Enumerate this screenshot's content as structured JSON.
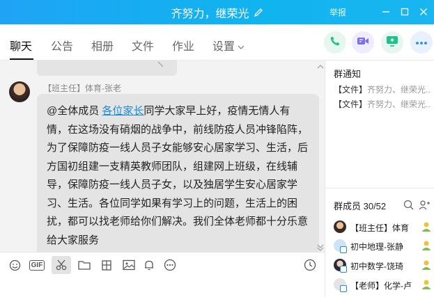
{
  "window": {
    "title": "齐努力，继荣光",
    "report_label": "举报"
  },
  "tabs": [
    {
      "label": "聊天",
      "active": true
    },
    {
      "label": "公告"
    },
    {
      "label": "相册"
    },
    {
      "label": "文件"
    },
    {
      "label": "作业"
    },
    {
      "label": "设置"
    }
  ],
  "message": {
    "sender": "【班主任】体育-张老",
    "mention": "@全体成员",
    "mention_link": "各位家长",
    "body": "同学大家早上好，疫情无情人有情，在这场没有硝烟的战争中，前线防疫人员冲锋陷阵，为了保障防疫一线人员子女能够安心居家学习、生活，后方国初组建一支精英教师团队，组建网上班级，在线辅导，保障防疫一线人员子女，以及独居学生安心居家学习、生活。各位同学如果有学习上的问题，生活上的困扰，都可以找老师给你们解决。我们全体老师都十分乐意给大家服务"
  },
  "side": {
    "notice_title": "群通知",
    "notices": [
      {
        "tag": "【文件】",
        "text": "齐努力、继荣光..."
      },
      {
        "tag": "【文件】",
        "text": "齐努力、继荣光..."
      }
    ],
    "members_title": "群成员 30/52",
    "members": [
      {
        "name": "【班主任】体育"
      },
      {
        "name": "初中地理-张静"
      },
      {
        "name": "初中数学-饶琦"
      },
      {
        "name": "【老师】化学-卢"
      }
    ]
  },
  "colors": {
    "titlebar": "#19b0f1",
    "mention": "#1a8ad8",
    "phone": "#21c08b",
    "video": "#7b6cf0",
    "share": "#1ec18a",
    "more": "#3a8ff0"
  }
}
